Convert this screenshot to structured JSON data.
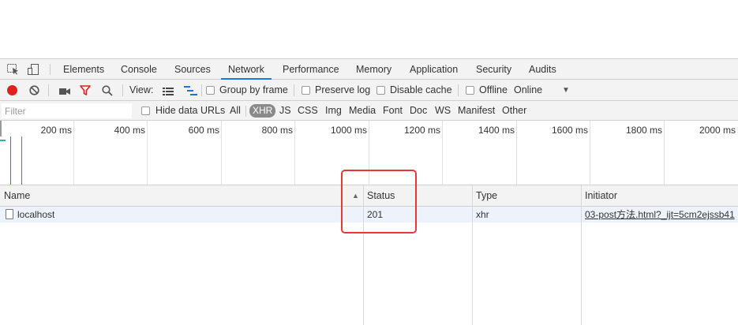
{
  "tabs": {
    "items": [
      {
        "label": "Elements"
      },
      {
        "label": "Console"
      },
      {
        "label": "Sources"
      },
      {
        "label": "Network"
      },
      {
        "label": "Performance"
      },
      {
        "label": "Memory"
      },
      {
        "label": "Application"
      },
      {
        "label": "Security"
      },
      {
        "label": "Audits"
      }
    ],
    "active": "Network"
  },
  "toolbar": {
    "view_label": "View:",
    "group_by_frame": "Group by frame",
    "preserve_log": "Preserve log",
    "disable_cache": "Disable cache",
    "offline": "Offline",
    "throttle_value": "Online"
  },
  "filter": {
    "placeholder": "Filter",
    "hide_data_urls": "Hide data URLs",
    "types": [
      {
        "label": "All"
      },
      {
        "label": "XHR"
      },
      {
        "label": "JS"
      },
      {
        "label": "CSS"
      },
      {
        "label": "Img"
      },
      {
        "label": "Media"
      },
      {
        "label": "Font"
      },
      {
        "label": "Doc"
      },
      {
        "label": "WS"
      },
      {
        "label": "Manifest"
      },
      {
        "label": "Other"
      }
    ],
    "active_type": "XHR"
  },
  "timeline": {
    "ticks": [
      "200 ms",
      "400 ms",
      "600 ms",
      "800 ms",
      "1000 ms",
      "1200 ms",
      "1400 ms",
      "1600 ms",
      "1800 ms",
      "2000 ms"
    ]
  },
  "table": {
    "columns": {
      "name": "Name",
      "status": "Status",
      "type": "Type",
      "initiator": "Initiator"
    },
    "rows": [
      {
        "name": "localhost",
        "status": "201",
        "type": "xhr",
        "initiator": "03-post方法.html?_ijt=5cm2ejssb41"
      }
    ]
  },
  "colors": {
    "active_tab_underline": "#1a73e8",
    "record_button": "#e0201c",
    "filter_icon": "#e0201c",
    "highlight_box": "#e53935",
    "row_selected": "#eef3fb"
  }
}
